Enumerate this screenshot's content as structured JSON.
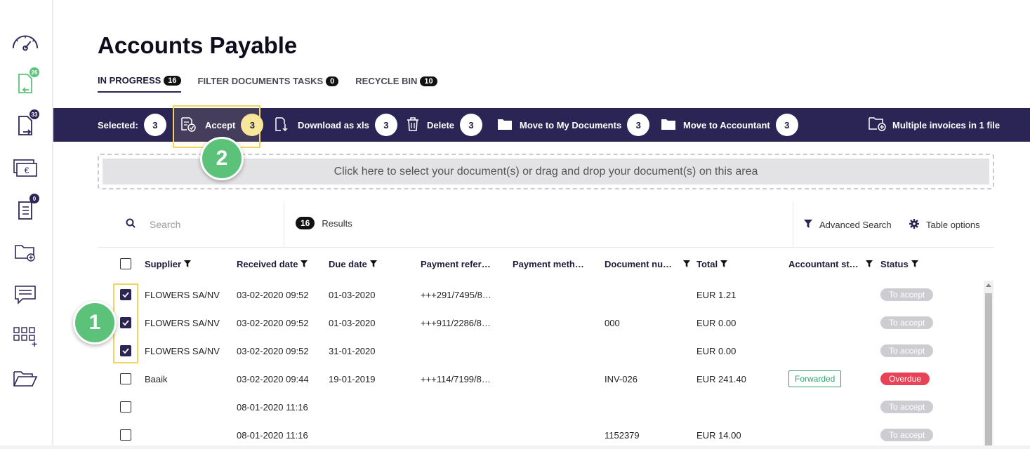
{
  "page": {
    "title": "Accounts Payable"
  },
  "sidebar": {
    "items": [
      {
        "name": "dashboard",
        "badge": ""
      },
      {
        "name": "incoming-documents",
        "badge": "26",
        "badge_color": "#5cc27a"
      },
      {
        "name": "outgoing-documents",
        "badge": "33",
        "badge_color": "#2b2556"
      },
      {
        "name": "payments",
        "badge": ""
      },
      {
        "name": "tasks",
        "badge": "0",
        "badge_color": "#2b2556"
      },
      {
        "name": "add-folder",
        "badge": ""
      },
      {
        "name": "messages",
        "badge": ""
      },
      {
        "name": "apps",
        "badge": ""
      },
      {
        "name": "folder",
        "badge": ""
      }
    ]
  },
  "tabs": [
    {
      "label": "IN PROGRESS",
      "count": "16",
      "active": true
    },
    {
      "label": "FILTER DOCUMENTS TASKS",
      "count": "0",
      "active": false
    },
    {
      "label": "RECYCLE BIN",
      "count": "10",
      "active": false
    }
  ],
  "actionbar": {
    "selected_label": "Selected:",
    "selected_count": "3",
    "accept_label": "Accept",
    "accept_count": "3",
    "download_label": "Download as xls",
    "download_count": "3",
    "delete_label": "Delete",
    "delete_count": "3",
    "move_my_docs_label": "Move to My Documents",
    "move_my_docs_count": "3",
    "move_accountant_label": "Move to Accountant",
    "move_accountant_count": "3",
    "multiple_label": "Multiple invoices in 1 file"
  },
  "steps": {
    "one": "1",
    "two": "2"
  },
  "dropzone": {
    "text": "Click here to select your document(s) or drag and drop your document(s) on this area"
  },
  "toolbar": {
    "search_placeholder": "Search",
    "results_count": "16",
    "results_label": "Results",
    "advanced_search": "Advanced Search",
    "table_options": "Table options"
  },
  "columns": [
    {
      "label": "Supplier",
      "filter": true
    },
    {
      "label": "Received date",
      "filter": true
    },
    {
      "label": "Due date",
      "filter": true
    },
    {
      "label": "Payment refer…",
      "filter": false
    },
    {
      "label": "Payment meth…",
      "filter": false
    },
    {
      "label": "Document nu…",
      "filter": true
    },
    {
      "label": "Total",
      "filter": true
    },
    {
      "label": "Accountant st…",
      "filter": true
    },
    {
      "label": "Status",
      "filter": true
    }
  ],
  "rows": [
    {
      "checked": true,
      "supplier": "FLOWERS SA/NV",
      "received": "03-02-2020 09:52",
      "due": "01-03-2020",
      "payref": "+++291/7495/8…",
      "docnum": "",
      "total": "EUR 1.21",
      "accountant": "",
      "status": "To accept",
      "status_type": "grey"
    },
    {
      "checked": true,
      "supplier": "FLOWERS SA/NV",
      "received": "03-02-2020 09:52",
      "due": "01-03-2020",
      "payref": "+++911/2286/8…",
      "docnum": "000",
      "total": "EUR 0.00",
      "accountant": "",
      "status": "To accept",
      "status_type": "grey"
    },
    {
      "checked": true,
      "supplier": "FLOWERS SA/NV",
      "received": "03-02-2020 09:52",
      "due": "31-01-2020",
      "payref": "",
      "docnum": "",
      "total": "EUR 0.00",
      "accountant": "",
      "status": "To accept",
      "status_type": "grey"
    },
    {
      "checked": false,
      "supplier": "Baaik",
      "received": "03-02-2020 09:44",
      "due": "19-01-2019",
      "payref": "+++114/7199/8…",
      "docnum": "INV-026",
      "total": "EUR 241.40",
      "accountant": "Forwarded",
      "status": "Overdue",
      "status_type": "red"
    },
    {
      "checked": false,
      "supplier": "",
      "received": "08-01-2020 11:16",
      "due": "",
      "payref": "",
      "docnum": "",
      "total": "",
      "accountant": "",
      "status": "To accept",
      "status_type": "grey"
    },
    {
      "checked": false,
      "supplier": "",
      "received": "08-01-2020 11:16",
      "due": "",
      "payref": "",
      "docnum": "1152379",
      "total": "EUR 14.00",
      "accountant": "",
      "status": "To accept",
      "status_type": "grey"
    }
  ]
}
